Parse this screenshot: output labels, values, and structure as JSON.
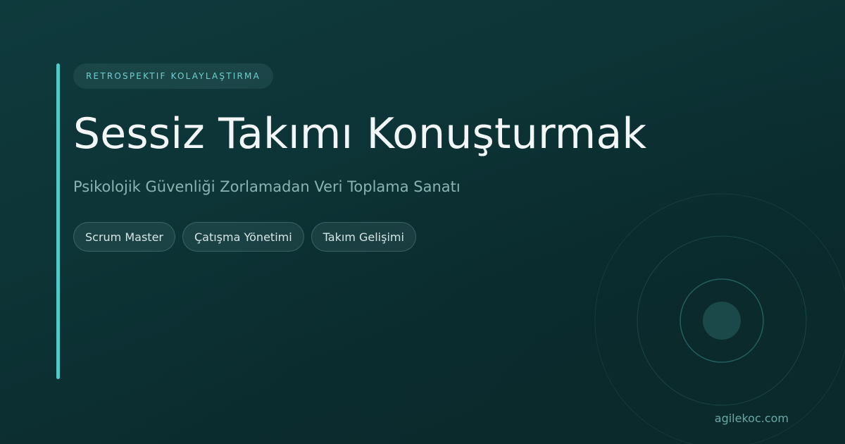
{
  "eyebrow": "RETROSPEKTIF KOLAYLAŞTIRMA",
  "title": "Sessiz Takımı Konuşturmak",
  "subtitle": "Psikolojik Güvenliği Zorlamadan Veri Toplama Sanatı",
  "tags": [
    "Scrum Master",
    "Çatışma Yönetimi",
    "Takım Gelişimi"
  ],
  "footer": "agilekoc.com",
  "colors": {
    "accent": "#4fc9c9",
    "background": "#0d3436",
    "title": "#f2f6f6",
    "subtitle": "#8ab3b3",
    "eyebrow": "#6fd0cf"
  },
  "decoration": "concentric-circles-icon"
}
